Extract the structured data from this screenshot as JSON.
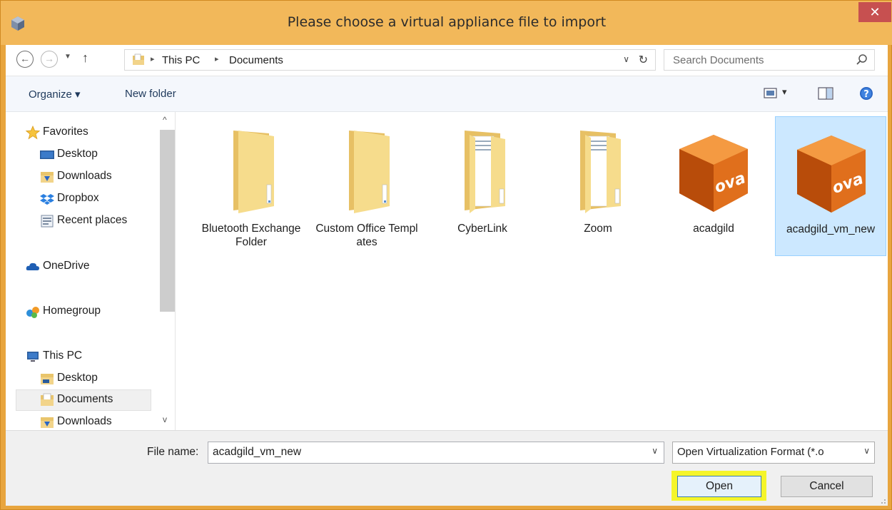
{
  "window": {
    "title": "Please choose a virtual appliance file to import",
    "close_glyph": "✕"
  },
  "address": {
    "back_glyph": "←",
    "forward_glyph": "→",
    "recent_glyph": "▼",
    "up_glyph": "↑",
    "breadcrumbs": [
      "This PC",
      "Documents"
    ],
    "separator_glyph": "▸",
    "dropdown_glyph": "∨",
    "refresh_glyph": "↻",
    "search_placeholder": "Search Documents"
  },
  "toolbar": {
    "organize_label": "Organize ▾",
    "new_folder_label": "New folder",
    "view_dropdown_glyph": "▾"
  },
  "sidebar": {
    "scroll_up_glyph": "^",
    "scroll_down_glyph": "v",
    "items": [
      {
        "label": "Favorites",
        "icon": "star-icon"
      },
      {
        "label": "Desktop",
        "icon": "desktop-icon"
      },
      {
        "label": "Downloads",
        "icon": "downloads-icon"
      },
      {
        "label": "Dropbox",
        "icon": "dropbox-icon"
      },
      {
        "label": "Recent places",
        "icon": "recent-places-icon"
      },
      {
        "label": "OneDrive",
        "icon": "onedrive-icon"
      },
      {
        "label": "Homegroup",
        "icon": "homegroup-icon"
      },
      {
        "label": "This PC",
        "icon": "this-pc-icon"
      },
      {
        "label": "Desktop",
        "icon": "desktop-folder-icon"
      },
      {
        "label": "Documents",
        "icon": "documents-folder-icon",
        "selected": true
      },
      {
        "label": "Downloads",
        "icon": "downloads-folder-icon"
      }
    ]
  },
  "files": [
    {
      "name": "Bluetooth Exchange Folder",
      "type": "folder"
    },
    {
      "name": "Custom Office Templates",
      "type": "folder"
    },
    {
      "name": "CyberLink",
      "type": "folder-with-docs"
    },
    {
      "name": "Zoom",
      "type": "folder-with-docs"
    },
    {
      "name": "acadgild",
      "type": "ova",
      "badge": "ova"
    },
    {
      "name": "acadgild_vm_new",
      "type": "ova",
      "badge": "ova",
      "selected": true
    }
  ],
  "footer": {
    "file_name_label": "File name:",
    "file_name_value": "acadgild_vm_new",
    "file_type_value": "Open Virtualization Format (*.o",
    "dropdown_glyph": "∨",
    "open_label": "Open",
    "cancel_label": "Cancel",
    "highlight_color": "#f5f52a"
  }
}
